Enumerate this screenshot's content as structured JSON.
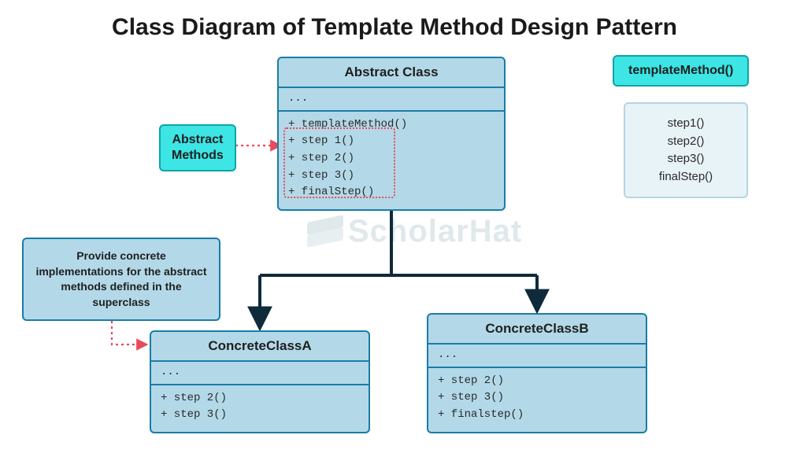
{
  "title": "Class Diagram of Template Method Design Pattern",
  "watermark": "ScholarHat",
  "abstract_class": {
    "name": "Abstract Class",
    "attrs": "...",
    "methods": [
      "+ templateMethod()",
      "+ step 1()",
      "+ step 2()",
      "+ step 3()",
      "+ finalStep()"
    ]
  },
  "concrete_a": {
    "name": "ConcreteClassA",
    "attrs": "...",
    "methods": [
      "+ step 2()",
      "+ step 3()"
    ]
  },
  "concrete_b": {
    "name": "ConcreteClassB",
    "attrs": "...",
    "methods": [
      "+ step 2()",
      "+ step 3()",
      "+ finalstep()"
    ]
  },
  "callout_abstract_methods": {
    "line1": "Abstract",
    "line2": "Methods"
  },
  "callout_concrete": "Provide concrete implementations for the abstract methods defined in the superclass",
  "template_method_label": "templateMethod()",
  "template_steps": [
    "step1()",
    "step2()",
    "step3()",
    "finalStep()"
  ]
}
